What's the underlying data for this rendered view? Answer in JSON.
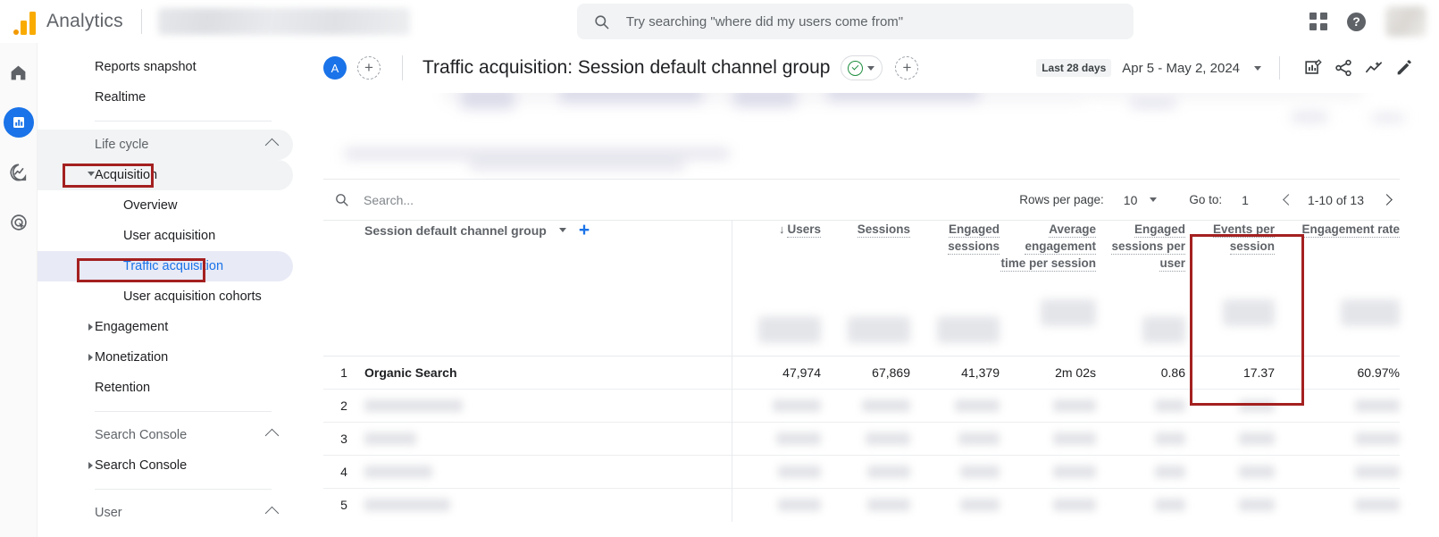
{
  "app": {
    "brand": "Analytics",
    "logo_icon": "analytics-bars-icon",
    "account_selector_blurred": true
  },
  "topbar": {
    "search_placeholder": "Try searching \"where did my users come from\"",
    "search_icon": "search-icon",
    "apps_icon": "apps-grid-icon",
    "help_icon": "help-circle-icon",
    "help_glyph": "?",
    "avatar_blurred": true
  },
  "rail": {
    "items": [
      {
        "name": "home",
        "icon": "home-icon",
        "active": false
      },
      {
        "name": "reports",
        "icon": "bar-chart-icon",
        "active": true
      },
      {
        "name": "explore",
        "icon": "explore-icon",
        "active": false
      },
      {
        "name": "advertising",
        "icon": "advertising-target-icon",
        "active": false
      }
    ]
  },
  "sidebar": {
    "items": [
      {
        "label": "Reports snapshot",
        "level": 1,
        "state": "normal"
      },
      {
        "label": "Realtime",
        "level": 1,
        "state": "normal"
      },
      {
        "divider": true
      },
      {
        "label": "Life cycle",
        "level": 1,
        "state": "section",
        "collapse_icon": "chevron-up-icon"
      },
      {
        "label": "Acquisition",
        "level": 1,
        "state": "hover",
        "caret": "down",
        "annotated": true
      },
      {
        "label": "Overview",
        "level": 2,
        "state": "normal"
      },
      {
        "label": "User acquisition",
        "level": 2,
        "state": "normal"
      },
      {
        "label": "Traffic acquisition",
        "level": 2,
        "state": "selected",
        "annotated": true
      },
      {
        "label": "User acquisition cohorts",
        "level": 2,
        "state": "normal"
      },
      {
        "label": "Engagement",
        "level": 1,
        "state": "normal",
        "caret": "right"
      },
      {
        "label": "Monetization",
        "level": 1,
        "state": "normal",
        "caret": "right"
      },
      {
        "label": "Retention",
        "level": 1,
        "state": "normal"
      },
      {
        "divider": true
      },
      {
        "label": "Search Console",
        "level": 1,
        "state": "section",
        "collapse_icon": "chevron-up-icon"
      },
      {
        "label": "Search Console",
        "level": 1,
        "state": "normal",
        "caret": "right"
      },
      {
        "divider": true
      },
      {
        "label": "User",
        "level": 1,
        "state": "section",
        "collapse_icon": "chevron-up-icon"
      }
    ]
  },
  "header": {
    "avatar_initial": "A",
    "add_collaborator_icon": "dashed-plus-icon",
    "title": "Traffic acquisition: Session default channel group",
    "validity_chip_icon": "green-check-circle-icon",
    "validity_chip_caret": "chevron-down-icon",
    "add_comparison_icon": "dashed-plus-icon",
    "date_badge": "Last 28 days",
    "date_range": "Apr 5 - May 2, 2024",
    "date_caret_icon": "chevron-down-icon",
    "actions": [
      {
        "name": "edit-chart-icon",
        "label": "Customize report"
      },
      {
        "name": "share-icon",
        "label": "Share this report"
      },
      {
        "name": "insights-icon",
        "label": "Insights"
      },
      {
        "name": "pencil-icon",
        "label": "Edit"
      }
    ]
  },
  "table_toolbar": {
    "search_icon": "search-icon",
    "search_placeholder": "Search...",
    "rows_per_page_label": "Rows per page:",
    "rows_per_page_value": "10",
    "rows_caret_icon": "chevron-down-icon",
    "goto_label": "Go to:",
    "goto_value": "1",
    "prev_icon": "chevron-left-icon",
    "range_text": "1-10 of 13",
    "next_icon": "chevron-right-icon"
  },
  "table": {
    "dimension_label": "Session default channel group",
    "dimension_caret_icon": "chevron-down-icon",
    "add_dimension_icon": "plus-icon",
    "sort_icon": "arrow-down-icon",
    "columns": [
      {
        "label": "Users",
        "sorted": true
      },
      {
        "label": "Sessions",
        "sorted": false
      },
      {
        "label": "Engaged sessions",
        "sorted": false
      },
      {
        "label": "Average engagement time per session",
        "sorted": false
      },
      {
        "label": "Engaged sessions per user",
        "sorted": false
      },
      {
        "label": "Events per session",
        "sorted": false
      },
      {
        "label": "Engagement rate",
        "sorted": false,
        "annotated": true
      }
    ],
    "rows": [
      {
        "index": "1",
        "dimension": "Organic Search",
        "values": [
          "47,974",
          "67,869",
          "41,379",
          "2m 02s",
          "0.86",
          "17.37",
          "60.97%"
        ],
        "blurred": false
      },
      {
        "index": "2",
        "dimension": "",
        "values": [
          "",
          "",
          "",
          "",
          "",
          "",
          ""
        ],
        "blurred": true
      },
      {
        "index": "3",
        "dimension": "",
        "values": [
          "",
          "",
          "",
          "",
          "",
          "",
          ""
        ],
        "blurred": true
      },
      {
        "index": "4",
        "dimension": "",
        "values": [
          "",
          "",
          "",
          "",
          "",
          "",
          ""
        ],
        "blurred": true
      },
      {
        "index": "5",
        "dimension": "",
        "values": [
          "",
          "",
          "",
          "",
          "",
          "",
          ""
        ],
        "blurred": true
      }
    ],
    "totals_row_blurred": true
  },
  "annotations": {
    "color": "#a42020",
    "boxes": [
      {
        "target": "sidebar-item-acquisition"
      },
      {
        "target": "sidebar-item-traffic-acquisition"
      },
      {
        "target": "column-engagement-rate"
      }
    ]
  },
  "colors": {
    "accent_blue": "#1a73e8",
    "selected_nav_bg": "#e8eaf6",
    "annotation_red": "#a42020",
    "logo_orange": "#f9ab00",
    "green_check": "#1e8e3e"
  }
}
